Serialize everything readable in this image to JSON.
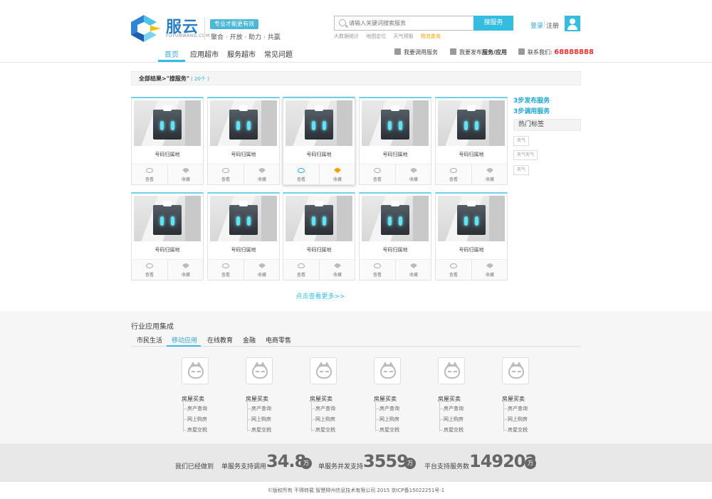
{
  "header": {
    "logo_text": "服云",
    "logo_sub": "FUYUNWANG.COM",
    "badge": "专业才能更有效",
    "slogan": "聚合 · 开放 · 助力 · 共赢",
    "search_placeholder": "请输入关键词搜索服务",
    "search_button": "搜服务",
    "hot_keys": [
      "大数据统计",
      "地图定位",
      "天气预报",
      "物流查询"
    ],
    "login": "登录",
    "register": "注册"
  },
  "nav": {
    "items": [
      "首页",
      "应用超市",
      "服务超市",
      "常见问题"
    ],
    "call_service": "我要调用服务",
    "publish_prefix": "我要发布",
    "publish_bold": "服务/应用",
    "contact_label": "联系我们:",
    "phone": "68888888"
  },
  "results": {
    "title": "全部结果>\"搜服务\"",
    "count": "( 20个 )"
  },
  "cards": [
    {
      "name": "号码归属地",
      "view": "查看",
      "fav": "收藏"
    },
    {
      "name": "号码归属地",
      "view": "查看",
      "fav": "收藏"
    },
    {
      "name": "号码归属地",
      "view": "查看",
      "fav": "收藏"
    },
    {
      "name": "号码归属地",
      "view": "查看",
      "fav": "收藏"
    },
    {
      "name": "号码归属地",
      "view": "查看",
      "fav": "收藏"
    },
    {
      "name": "号码归属地",
      "view": "查看",
      "fav": "收藏"
    },
    {
      "name": "号码归属地",
      "view": "查看",
      "fav": "收藏"
    },
    {
      "name": "号码归属地",
      "view": "查看",
      "fav": "收藏"
    },
    {
      "name": "号码归属地",
      "view": "查看",
      "fav": "收藏"
    },
    {
      "name": "号码归属地",
      "view": "查看",
      "fav": "收藏"
    }
  ],
  "sidebar": {
    "link1": "3步发布服务",
    "link2": "3步调用服务",
    "hot_tags_title": "热门标签",
    "tags": [
      "天气",
      "天气天气",
      "天气"
    ]
  },
  "more_link": "点击查看更多>>",
  "industry": {
    "title": "行业应用集成",
    "tabs": [
      "市民生活",
      "移动应用",
      "在线教育",
      "金融",
      "电商零售"
    ],
    "active_tab": 1,
    "columns": [
      {
        "head": "房屋买卖",
        "subs": [
          "房产查询",
          "网上购房",
          "房屋交税"
        ]
      },
      {
        "head": "房屋买卖",
        "subs": [
          "房产查询",
          "网上购房",
          "房屋交税"
        ]
      },
      {
        "head": "房屋买卖",
        "subs": [
          "房产查询",
          "网上购房",
          "房屋交税"
        ]
      },
      {
        "head": "房屋买卖",
        "subs": [
          "房产查询",
          "网上购房",
          "房屋交税"
        ]
      },
      {
        "head": "房屋买卖",
        "subs": [
          "房产查询",
          "网上购房",
          "房屋交税"
        ]
      },
      {
        "head": "房屋买卖",
        "subs": [
          "房产查询",
          "网上购房",
          "房屋交税"
        ]
      }
    ]
  },
  "stats": {
    "intro": "我们已经做到",
    "label1": "单服务支持调用",
    "value1": "34.8",
    "unit1": "万",
    "label2": "单服务并发支持",
    "value2": "3559",
    "unit2": "万",
    "label3": "平台支持服务数",
    "value3": "149202",
    "unit3": "万"
  },
  "footer": "©版权所有 不得转载 智慧柳州信息技术有限公司 2015 京ICP备15022251号-1",
  "colors": {
    "accent": "#34bde0",
    "highlight": "#f0a000",
    "phone": "#e33333"
  }
}
